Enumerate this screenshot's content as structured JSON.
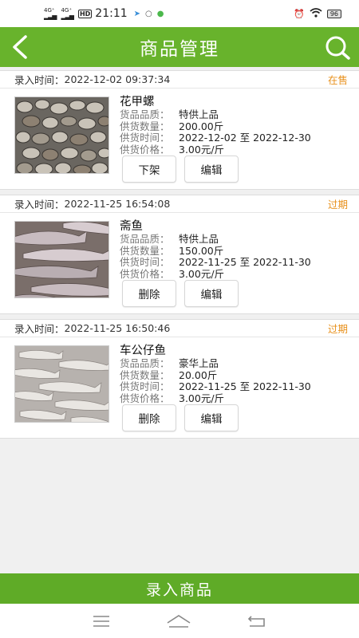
{
  "status_bar": {
    "sim1": "4G⁺",
    "sim2": "4G⁺",
    "hd": "HD",
    "time": "21:11",
    "battery": "96"
  },
  "header": {
    "title": "商品管理"
  },
  "products": [
    {
      "entry_label": "录入时间：",
      "entry_time": "2022-12-02 09:37:34",
      "status": "在售",
      "name": "花甲螺",
      "quality_label": "货品品质：",
      "quality": "特供上品",
      "quantity_label": "供货数量：",
      "quantity": "200.00斤",
      "period_label": "供货时间：",
      "period": "2022-12-02 至 2022-12-30",
      "price_label": "供货价格：",
      "price": "3.00元/斤",
      "action_label": "下架",
      "edit_label": "编辑"
    },
    {
      "entry_label": "录入时间：",
      "entry_time": "2022-11-25 16:54:08",
      "status": "过期",
      "name": "斋鱼",
      "quality_label": "货品品质：",
      "quality": "特供上品",
      "quantity_label": "供货数量：",
      "quantity": "150.00斤",
      "period_label": "供货时间：",
      "period": "2022-11-25 至 2022-11-30",
      "price_label": "供货价格：",
      "price": "3.00元/斤",
      "action_label": "删除",
      "edit_label": "编辑"
    },
    {
      "entry_label": "录入时间：",
      "entry_time": "2022-11-25 16:50:46",
      "status": "过期",
      "name": "车公仔鱼",
      "quality_label": "货品品质：",
      "quality": "豪华上品",
      "quantity_label": "供货数量：",
      "quantity": "20.00斤",
      "period_label": "供货时间：",
      "period": "2022-11-25 至 2022-11-30",
      "price_label": "供货价格：",
      "price": "3.00元/斤",
      "action_label": "删除",
      "edit_label": "编辑"
    }
  ],
  "footer": {
    "add_label": "录入商品"
  },
  "colors": {
    "accent": "#68b32c",
    "status": "#e8911d"
  },
  "icons": [
    "back-icon",
    "search-icon",
    "menu-icon",
    "home-icon",
    "return-icon"
  ]
}
